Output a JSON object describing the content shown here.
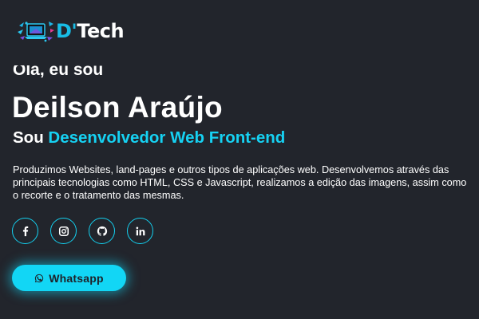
{
  "header": {
    "logo": {
      "letter": "D'",
      "word": "Tech",
      "accent_color": "#18bde6"
    }
  },
  "hero": {
    "greeting": "Olá, eu sou",
    "name": "Deilson Araújo",
    "role_prefix": "Sou",
    "role_highlight": "Desenvolvedor Web Front-end",
    "description": "Produzimos Websites, land-pages e outros tipos de aplicações web. Desenvolvemos através das principais tecnologias como HTML, CSS e Javascript, realizamos a edição das imagens, assim como o recorte e o tratamento das mesmas.",
    "accent_color": "#16d2f3"
  },
  "socials": [
    {
      "icon": "facebook-icon"
    },
    {
      "icon": "instagram-icon"
    },
    {
      "icon": "github-icon"
    },
    {
      "icon": "linkedin-icon"
    }
  ],
  "cta": {
    "label": "Whatsapp",
    "icon": "whatsapp-icon",
    "color": "#12d6f5"
  },
  "background_color": "#22252c"
}
